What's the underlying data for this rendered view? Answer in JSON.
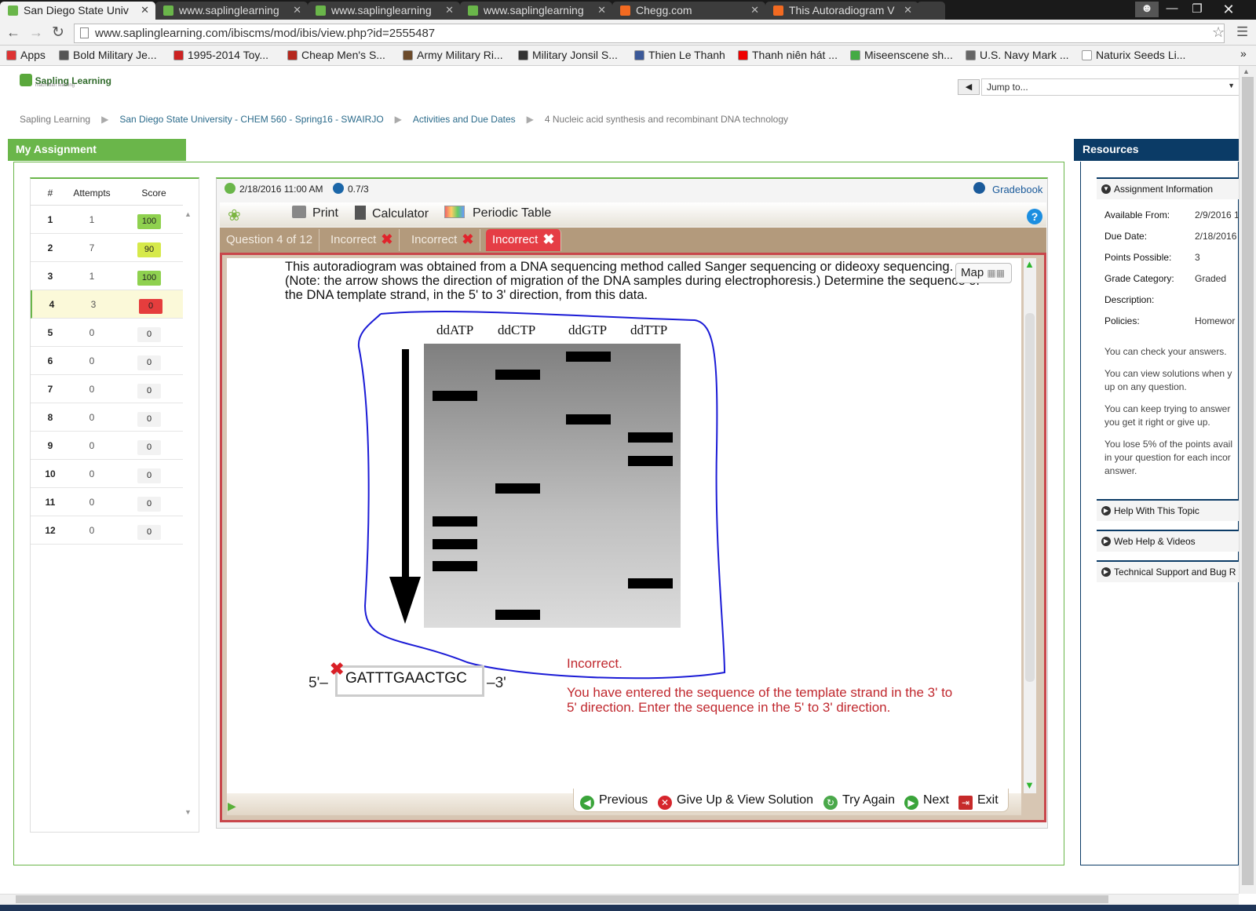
{
  "browser": {
    "tabs": [
      {
        "title": "San Diego State Univ",
        "active": true,
        "icon": "sapling-leaf-icon"
      },
      {
        "title": "www.saplinglearning",
        "active": false,
        "icon": "sapling-leaf-icon"
      },
      {
        "title": "www.saplinglearning",
        "active": false,
        "icon": "sapling-leaf-icon"
      },
      {
        "title": "www.saplinglearning",
        "active": false,
        "icon": "sapling-leaf-icon"
      },
      {
        "title": "Chegg.com",
        "active": false,
        "icon": "chegg-icon"
      },
      {
        "title": "This Autoradiogram V",
        "active": false,
        "icon": "chegg-icon"
      }
    ],
    "url": "www.saplinglearning.com/ibiscms/mod/ibis/view.php?id=2555487",
    "bookmarks": [
      {
        "label": "Apps"
      },
      {
        "label": "Bold Military Je..."
      },
      {
        "label": "1995-2014 Toy..."
      },
      {
        "label": "Cheap Men's S..."
      },
      {
        "label": "Army Military Ri..."
      },
      {
        "label": "Military Jonsil S..."
      },
      {
        "label": "Thien Le Thanh"
      },
      {
        "label": "Thanh niên hát ..."
      },
      {
        "label": "Miseenscene sh..."
      },
      {
        "label": "U.S. Navy Mark ..."
      },
      {
        "label": "Naturix Seeds Li..."
      }
    ],
    "bookmarks_more": "»"
  },
  "header": {
    "logo": "Sapling Learning",
    "logo_sub": "macmillan learning",
    "jump_label": "Jump to...",
    "breadcrumb": [
      "Sapling Learning",
      "San Diego State University - CHEM 560 - Spring16 - SWAIRJO",
      "Activities and Due Dates",
      "4 Nucleic acid synthesis and recombinant DNA technology"
    ]
  },
  "my_assignment": {
    "title": "My Assignment",
    "columns": [
      "#",
      "Attempts",
      "Score"
    ],
    "rows": [
      {
        "num": "1",
        "attempts": "1",
        "score": "100",
        "status": "full"
      },
      {
        "num": "2",
        "attempts": "7",
        "score": "90",
        "status": "partial"
      },
      {
        "num": "3",
        "attempts": "1",
        "score": "100",
        "status": "full"
      },
      {
        "num": "4",
        "attempts": "3",
        "score": "0",
        "status": "wrong"
      },
      {
        "num": "5",
        "attempts": "0",
        "score": "0",
        "status": "none"
      },
      {
        "num": "6",
        "attempts": "0",
        "score": "0",
        "status": "none"
      },
      {
        "num": "7",
        "attempts": "0",
        "score": "0",
        "status": "none"
      },
      {
        "num": "8",
        "attempts": "0",
        "score": "0",
        "status": "none"
      },
      {
        "num": "9",
        "attempts": "0",
        "score": "0",
        "status": "none"
      },
      {
        "num": "10",
        "attempts": "0",
        "score": "0",
        "status": "none"
      },
      {
        "num": "11",
        "attempts": "0",
        "score": "0",
        "status": "none"
      },
      {
        "num": "12",
        "attempts": "0",
        "score": "0",
        "status": "none"
      }
    ],
    "colors": {
      "full": "#8fd14f",
      "partial": "#d6e94a",
      "wrong": "#e53d3d",
      "none": "#f2f2f2"
    }
  },
  "question": {
    "due": "2/18/2016 11:00 AM",
    "points": "0.7/3",
    "gradebook": "Gradebook",
    "tools": {
      "print": "Print",
      "calculator": "Calculator",
      "periodic_table": "Periodic Table"
    },
    "tabs": {
      "position": "Question 4 of 12",
      "attempt1": "Incorrect",
      "attempt2": "Incorrect",
      "attempt3": "Incorrect"
    },
    "text": "This autoradiogram was obtained from a DNA sequencing method called Sanger sequencing or dideoxy sequencing. (Note: the arrow shows the direction of migration of the DNA samples during electrophoresis.) Determine the sequence of the DNA template strand, in the 5' to 3' direction, from this data.",
    "map_label": "Map",
    "lanes": [
      "ddATP",
      "ddCTP",
      "ddGTP",
      "ddTTP"
    ],
    "answer_prefix": "5'–",
    "answer_suffix": "–3'",
    "answer_value": "GATTTGAACTGC",
    "feedback_title": "Incorrect.",
    "feedback_text": "You have entered the sequence of the template strand in the 3' to 5' direction. Enter the sequence in the 5' to 3' direction.",
    "buttons": {
      "previous": "Previous",
      "give_up": "Give Up & View Solution",
      "try_again": "Try Again",
      "next": "Next",
      "exit": "Exit"
    }
  },
  "resources": {
    "title": "Resources",
    "assignment_info": "Assignment Information",
    "info": {
      "available_from_label": "Available From:",
      "available_from": "2/9/2016 1",
      "due_date_label": "Due Date:",
      "due_date": "2/18/2016",
      "points_label": "Points Possible:",
      "points": "3",
      "grade_cat_label": "Grade Category:",
      "grade_cat": "Graded",
      "description_label": "Description:",
      "policies_label": "Policies:",
      "policies": "Homewor"
    },
    "policy_lines": [
      [
        "You can check your answers."
      ],
      [
        "You can view solutions when y",
        "up on any question."
      ],
      [
        "You can keep trying to answer",
        "you get it right or give up."
      ],
      [
        "You lose 5% of the points avail",
        "in your question for each incor",
        "answer."
      ]
    ],
    "sections": [
      "Help With This Topic",
      "Web Help & Videos",
      "Technical Support and Bug R"
    ]
  }
}
